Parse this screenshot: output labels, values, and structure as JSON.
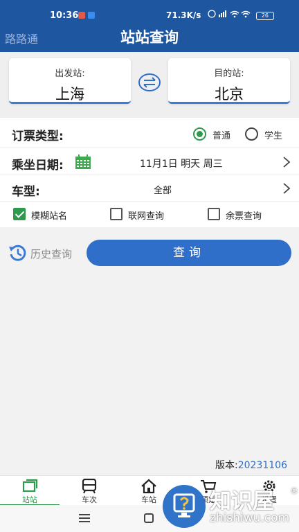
{
  "status_bar": {
    "time": "10:36",
    "net_speed": "71.3K/s",
    "battery": "26"
  },
  "header": {
    "app_name": "路路通",
    "title": "站站查询"
  },
  "stations": {
    "from_label": "出发站:",
    "from_value": "上海",
    "to_label": "目的站:",
    "to_value": "北京"
  },
  "ticket_type": {
    "label": "订票类型:",
    "options": [
      {
        "label": "普通",
        "selected": true
      },
      {
        "label": "学生",
        "selected": false
      }
    ]
  },
  "date": {
    "label": "乘坐日期:",
    "value": "11月1日 明天 周三"
  },
  "train_type": {
    "label": "车型:",
    "value": "全部"
  },
  "checkboxes": [
    {
      "label": "模糊站名",
      "checked": true
    },
    {
      "label": "联网查询",
      "checked": false
    },
    {
      "label": "余票查询",
      "checked": false
    }
  ],
  "history_label": "历史查询",
  "query_button": "查询",
  "version": {
    "label": "版本:",
    "value": "20231106"
  },
  "tabs": [
    {
      "label": "站站",
      "icon": "station-to-station-icon",
      "active": true
    },
    {
      "label": "车次",
      "icon": "train-icon",
      "active": false
    },
    {
      "label": "车站",
      "icon": "house-icon",
      "active": false
    },
    {
      "label": "预定",
      "icon": "cart-icon",
      "active": false
    },
    {
      "label": "设置",
      "icon": "gear-icon",
      "active": false
    }
  ],
  "watermark": {
    "text": "知识屋",
    "url": "zhishiwu.com"
  },
  "colors": {
    "header_bg": "#1e56a0",
    "accent_blue": "#2f6ec9",
    "accent_green": "#2e9a4e"
  }
}
